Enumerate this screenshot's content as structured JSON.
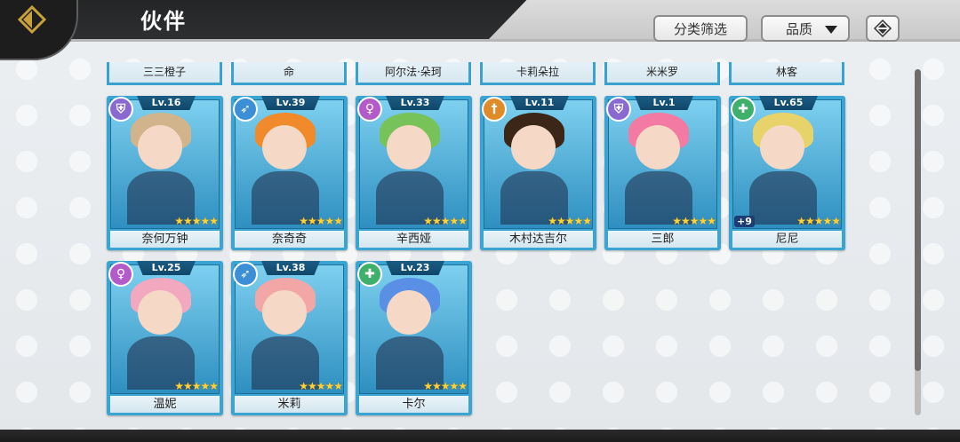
{
  "header": {
    "title": "伙伴",
    "filter_label": "分类筛选",
    "quality_label": "品质",
    "back_icon": "back-arrow-icon",
    "sort_icon": "sort-toggle-icon"
  },
  "top_row_names": [
    "三三橙子",
    "命",
    "阿尔法·朵珂",
    "卡莉朵拉",
    "米米罗",
    "林客"
  ],
  "cards": [
    {
      "name": "奈何万钟",
      "level": "Lv.16",
      "class_icon": "shield-class-icon",
      "class_color": "#8a6ad1",
      "hair": "#d2b48c",
      "stars": "★★★★★"
    },
    {
      "name": "奈奇奇",
      "level": "Lv.39",
      "class_icon": "bow-class-icon",
      "class_color": "#3c8fd6",
      "hair": "#f08a2a",
      "stars": "★★★★★"
    },
    {
      "name": "辛西娅",
      "level": "Lv.33",
      "class_icon": "female-class-icon",
      "class_color": "#b25bc9",
      "hair": "#78c25a",
      "stars": "★★★★★"
    },
    {
      "name": "木村达吉尔",
      "level": "Lv.11",
      "class_icon": "sword-class-icon",
      "class_color": "#e08b2a",
      "hair": "#3b2618",
      "stars": "★★★★★"
    },
    {
      "name": "三郎",
      "level": "Lv.1",
      "class_icon": "shield-class-icon",
      "class_color": "#8a6ad1",
      "hair": "#f27aa3",
      "stars": "★★★★★"
    },
    {
      "name": "尼尼",
      "level": "Lv.65",
      "class_icon": "heal-class-icon",
      "class_color": "#3fb06c",
      "hair": "#e8d36a",
      "stars": "★★★★★",
      "plus": "+9"
    },
    {
      "name": "温妮",
      "level": "Lv.25",
      "class_icon": "female-class-icon",
      "class_color": "#b25bc9",
      "hair": "#f2a9c0",
      "stars": "★★★★★"
    },
    {
      "name": "米莉",
      "level": "Lv.38",
      "class_icon": "bow-class-icon",
      "class_color": "#3c8fd6",
      "hair": "#f3a6a6",
      "stars": "★★★★★"
    },
    {
      "name": "卡尔",
      "level": "Lv.23",
      "class_icon": "heal-class-icon",
      "class_color": "#3fb06c",
      "hair": "#5a8fe6",
      "stars": "★★★★★"
    }
  ]
}
